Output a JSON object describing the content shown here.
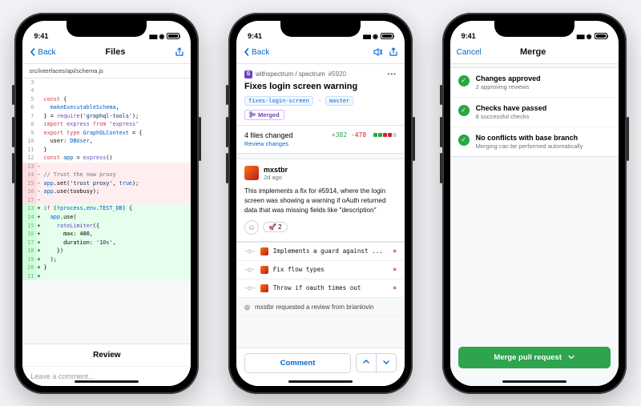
{
  "status": {
    "time": "9:41"
  },
  "files": {
    "back": "Back",
    "title": "Files",
    "path": "src/interfaces/api/schema.js",
    "lines": [
      {
        "n": 3,
        "type": "ctx",
        "txt": ""
      },
      {
        "n": 4,
        "type": "ctx",
        "txt": ""
      },
      {
        "n": 5,
        "type": "ctx",
        "txt": "const {"
      },
      {
        "n": 6,
        "type": "ctx",
        "txt": "  makeExecutableSchema,"
      },
      {
        "n": 7,
        "type": "ctx",
        "txt": "} = require('graphql-tools');"
      },
      {
        "n": 8,
        "type": "ctx",
        "txt": "import express from 'express'"
      },
      {
        "n": 9,
        "type": "ctx",
        "txt": "export type GraphQLContext = {"
      },
      {
        "n": 10,
        "type": "ctx",
        "txt": "  user: DBUser,"
      },
      {
        "n": 11,
        "type": "ctx",
        "txt": "}"
      },
      {
        "n": 12,
        "type": "ctx",
        "txt": "const app = express()"
      },
      {
        "n": 13,
        "type": "del",
        "txt": ""
      },
      {
        "n": 14,
        "type": "del",
        "txt": "// Trust the now proxy"
      },
      {
        "n": 15,
        "type": "del",
        "txt": "app.set('trust proxy', true);"
      },
      {
        "n": 16,
        "type": "del",
        "txt": "app.use(toobusy);"
      },
      {
        "n": 17,
        "type": "del",
        "txt": ""
      },
      {
        "n": 13,
        "type": "add",
        "txt": "if (!process.env.TEST_DB) {"
      },
      {
        "n": 14,
        "type": "add",
        "txt": "  app.use("
      },
      {
        "n": 15,
        "type": "add",
        "txt": "    rateLimiter({"
      },
      {
        "n": 16,
        "type": "add",
        "txt": "      max: 480,"
      },
      {
        "n": 17,
        "type": "add",
        "txt": "      duration: '10s',"
      },
      {
        "n": 18,
        "type": "add",
        "txt": "    })"
      },
      {
        "n": 19,
        "type": "add",
        "txt": "  );"
      },
      {
        "n": 20,
        "type": "add",
        "txt": "}"
      },
      {
        "n": 21,
        "type": "add",
        "txt": ""
      }
    ],
    "review_label": "Review",
    "comment_placeholder": "Leave a comment..."
  },
  "pr": {
    "back": "Back",
    "repo": "withspectrum / spectrum",
    "number": "#5920",
    "title": "Fixes login screen warning",
    "branch_from": "fixes-login-screen",
    "branch_to": "master",
    "state": "Merged",
    "files_changed": "4 files changed",
    "review_link": "Review changes",
    "additions": "+382",
    "deletions": "-478",
    "author": "mxstbr",
    "time": "2d ago",
    "body": "This implements a fix for #5914, where the login screen was showing a warning if oAuth returned data that was missing fields like \"description\"",
    "reaction_count": "2",
    "commits": [
      "Implements a guard against ...",
      "Fix flow types",
      "Throw if oauth times out"
    ],
    "review_request": "mxstbr requested a review from brianlovin",
    "comment_label": "Comment"
  },
  "merge": {
    "cancel": "Cancel",
    "title": "Merge",
    "rows": [
      {
        "title": "Changes approved",
        "sub": "2 approving reviews"
      },
      {
        "title": "Checks have passed",
        "sub": "8 successful checks"
      },
      {
        "title": "No conflicts with base branch",
        "sub": "Merging can be performed automatically"
      }
    ],
    "button": "Merge pull request"
  }
}
